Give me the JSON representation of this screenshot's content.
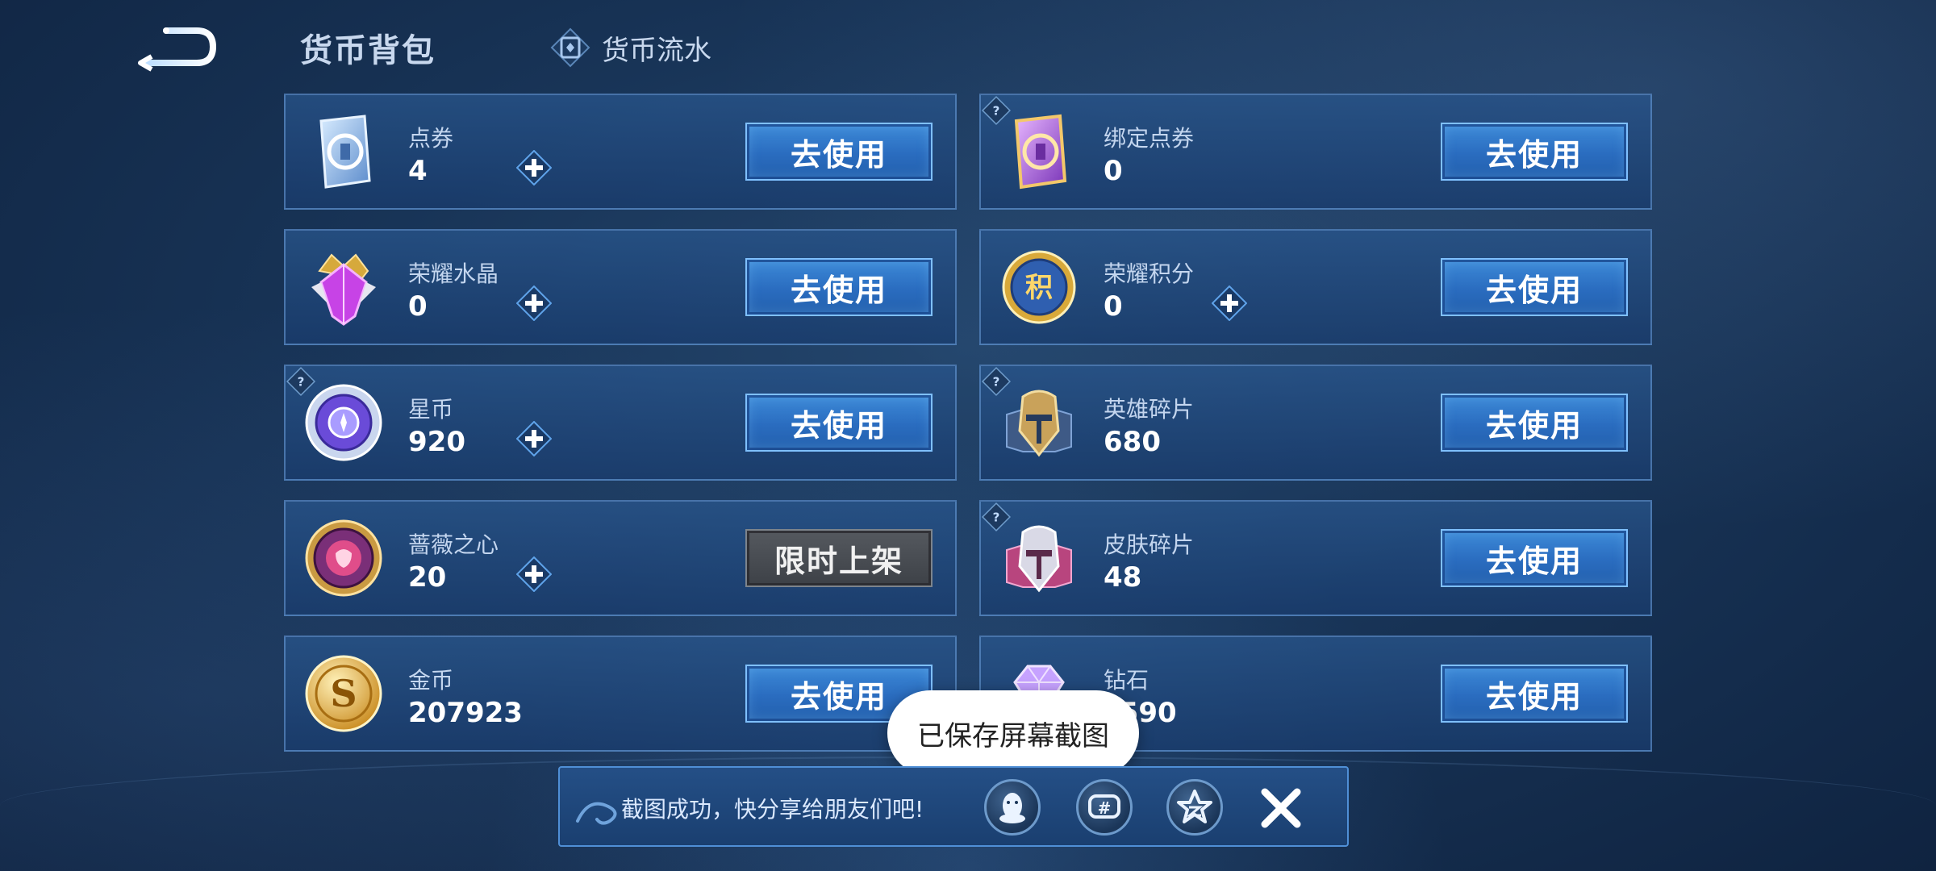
{
  "header": {
    "title": "货币背包",
    "flow_tab_label": "货币流水"
  },
  "currencies": [
    {
      "name": "点券",
      "value": "4",
      "button": "去使用",
      "icon": "ticket-card-icon"
    },
    {
      "name": "绑定点券",
      "value": "0",
      "button": "去使用",
      "icon": "bound-ticket-card-icon"
    },
    {
      "name": "荣耀水晶",
      "value": "0",
      "button": "去使用",
      "icon": "glory-crystal-icon"
    },
    {
      "name": "荣耀积分",
      "value": "0",
      "button": "去使用",
      "icon": "glory-points-icon"
    },
    {
      "name": "星币",
      "value": "920",
      "button": "去使用",
      "icon": "star-coin-icon"
    },
    {
      "name": "英雄碎片",
      "value": "680",
      "button": "去使用",
      "icon": "hero-fragment-icon"
    },
    {
      "name": "蔷薇之心",
      "value": "20",
      "button": "限时上架",
      "icon": "rose-heart-icon"
    },
    {
      "name": "皮肤碎片",
      "value": "48",
      "button": "去使用",
      "icon": "skin-fragment-icon"
    },
    {
      "name": "金币",
      "value": "207923",
      "button": "去使用",
      "icon": "gold-coin-icon"
    },
    {
      "name": "钻石",
      "value": "?590",
      "button": "去使用",
      "icon": "diamond-icon"
    }
  ],
  "toast": {
    "text": "已保存屏幕截图"
  },
  "share_bar": {
    "text": "截图成功，快分享给朋友们吧!",
    "icons": [
      "qq-icon",
      "moments-icon",
      "qzone-icon"
    ],
    "close_icon": "close-icon"
  },
  "colors": {
    "button_blue": "#2a6cbf",
    "button_limited_gray": "#484c52",
    "background": "#183457"
  }
}
